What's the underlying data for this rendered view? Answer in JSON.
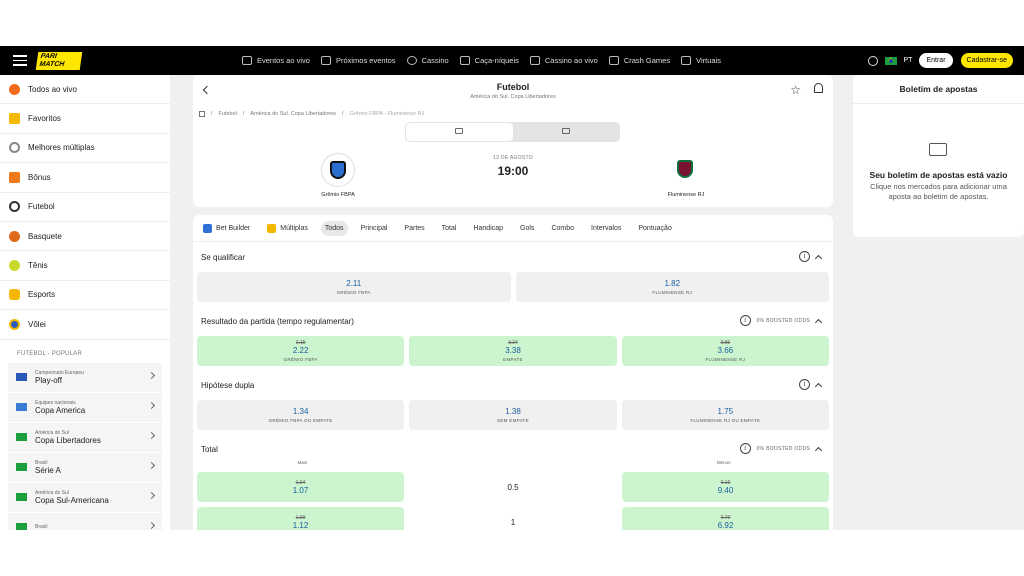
{
  "header": {
    "logo": "PARI MATCH",
    "nav": [
      {
        "label": "Eventos ao vivo",
        "icon": "live-tv-icon"
      },
      {
        "label": "Próximos eventos",
        "icon": "calendar-icon"
      },
      {
        "label": "Cassino",
        "icon": "casino-chip-icon"
      },
      {
        "label": "Caça-níqueis",
        "icon": "slot-icon"
      },
      {
        "label": "Cassino ao vivo",
        "icon": "live-casino-icon"
      },
      {
        "label": "Crash Games",
        "icon": "rocket-icon"
      },
      {
        "label": "Virtuais",
        "icon": "virtual-icon"
      }
    ],
    "lang": "PT",
    "login": "Entrar",
    "signup": "Cadastrar-se"
  },
  "sidebar": {
    "items": [
      {
        "label": "Todos ao vivo",
        "icon": "fire-icon",
        "color": "#f26b1d"
      },
      {
        "label": "Favoritos",
        "icon": "star-icon",
        "color": "#f5b800"
      },
      {
        "label": "Melhores múltiplas",
        "icon": "target-icon",
        "color": "#888"
      },
      {
        "label": "Bônus",
        "icon": "gift-icon",
        "color": "#f07a1a"
      },
      {
        "label": "Futebol",
        "icon": "soccer-ball-icon",
        "color": "#333"
      },
      {
        "label": "Basquete",
        "icon": "basketball-icon",
        "color": "#e06a1b"
      },
      {
        "label": "Tênis",
        "icon": "tennis-ball-icon",
        "color": "#c9d92b"
      },
      {
        "label": "Esports",
        "icon": "gamepad-icon",
        "color": "#f5b800"
      },
      {
        "label": "Vôlei",
        "icon": "volleyball-icon",
        "color": "#2d5db8"
      }
    ],
    "section": "FUTEBOL - POPULAR",
    "competitions": [
      {
        "sub": "Campeonato Europeu",
        "name": "Play-off",
        "flag": "#2a57b8"
      },
      {
        "sub": "Equipes nacionais",
        "name": "Copa America",
        "flag": "#3a7bd5"
      },
      {
        "sub": "América do Sul",
        "name": "Copa Libertadores",
        "flag": "#1b9e3e"
      },
      {
        "sub": "Brasil",
        "name": "Série A",
        "flag": "#1b9e3e"
      },
      {
        "sub": "América do Sul",
        "name": "Copa Sul-Americana",
        "flag": "#1b9e3e"
      },
      {
        "sub": "Brasil",
        "name": "",
        "flag": "#1b9e3e"
      }
    ]
  },
  "event": {
    "title": "Futebol",
    "subtitle": "América do Sul. Copa Libertadores",
    "breadcrumb": [
      "Futebol",
      "América do Sul. Copa Libertadores",
      "Grêmio FBPA - Fluminense RJ"
    ],
    "date": "13 DE AGOSTO",
    "time": "19:00",
    "home": "Grêmio FBPA",
    "away": "Fluminense RJ"
  },
  "tabs": [
    "Bet Builder",
    "Múltiplas",
    "Todos",
    "Principal",
    "Partes",
    "Total",
    "Handicap",
    "Gols",
    "Combo",
    "Intervalos",
    "Pontuação"
  ],
  "markets": {
    "qualify": {
      "title": "Se qualificar",
      "odds": [
        {
          "val": "2.11",
          "lab": "GRÊMIO FBPA"
        },
        {
          "val": "1.82",
          "lab": "FLUMINENSE RJ"
        }
      ]
    },
    "result": {
      "title": "Resultado da partida (tempo regulamentar)",
      "boost": "0% BOOSTED ODDS",
      "odds": [
        {
          "old": "2.15",
          "val": "2.22",
          "lab": "GRÊMIO FBPA"
        },
        {
          "old": "3.27",
          "val": "3.38",
          "lab": "EMPATE"
        },
        {
          "old": "3.55",
          "val": "3.66",
          "lab": "FLUMINENSE RJ"
        }
      ]
    },
    "double": {
      "title": "Hipótese dupla",
      "odds": [
        {
          "val": "1.34",
          "lab": "GRÊMIO FBPA OU EMPATE"
        },
        {
          "val": "1.38",
          "lab": "SEM EMPATE"
        },
        {
          "val": "1.75",
          "lab": "FLUMINENSE RJ OU EMPATE"
        }
      ]
    },
    "total": {
      "title": "Total",
      "boost": "0% BOOSTED ODDS",
      "over_label": "Mais",
      "under_label": "Menos",
      "rows": [
        {
          "line": "0.5",
          "over_old": "1.04",
          "over": "1.07",
          "under_old": "9.10",
          "under": "9.40"
        },
        {
          "line": "1",
          "over_old": "1.09",
          "over": "1.12",
          "under_old": "6.70",
          "under": "6.92"
        }
      ]
    }
  },
  "slip": {
    "title": "Boletim de apostas",
    "empty": "Seu boletim de apostas está vazio",
    "hint": "Clique nos mercados para adicionar uma aposta ao boletim de apostas."
  }
}
